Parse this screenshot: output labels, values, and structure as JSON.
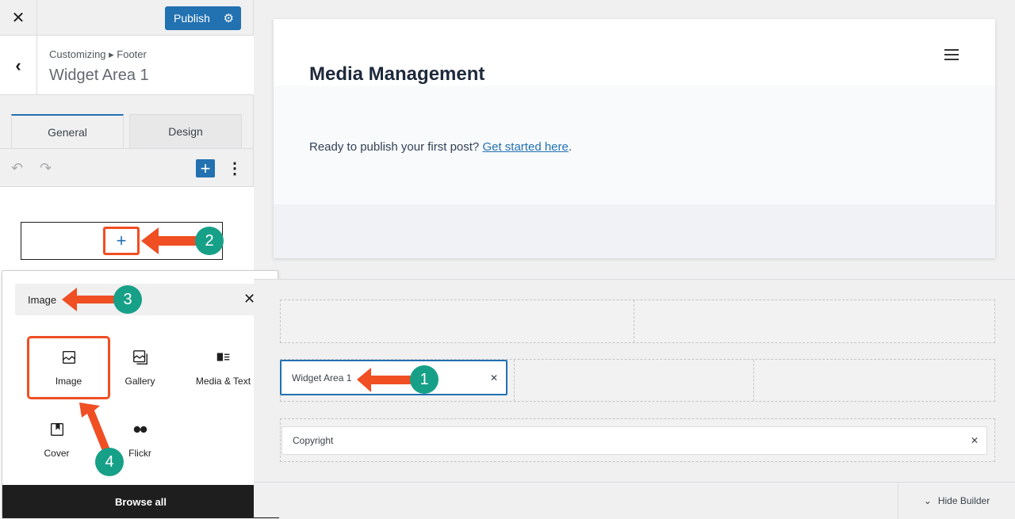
{
  "sidebar": {
    "close_icon": "close-icon",
    "publish_label": "Publish",
    "breadcrumb": "Customizing ▸ Footer",
    "title": "Widget Area 1",
    "tabs": [
      {
        "label": "General",
        "active": true
      },
      {
        "label": "Design",
        "active": false
      }
    ]
  },
  "inserter": {
    "search_value": "Image",
    "blocks": [
      {
        "label": "Image",
        "icon": "image-icon"
      },
      {
        "label": "Gallery",
        "icon": "gallery-icon"
      },
      {
        "label": "Media & Text",
        "icon": "media-text-icon"
      },
      {
        "label": "Cover",
        "icon": "cover-icon"
      },
      {
        "label": "Flickr",
        "icon": "flickr-icon"
      }
    ],
    "browse_all": "Browse all"
  },
  "preview": {
    "site_title": "Media Management",
    "intro_text": "Ready to publish your first post? ",
    "intro_link": "Get started here",
    "intro_end": "."
  },
  "builder": {
    "widget_item": "Widget Area 1",
    "copyright_item": "Copyright",
    "hide_builder": "Hide Builder"
  },
  "annotations": {
    "step1": "1",
    "step2": "2",
    "step3": "3",
    "step4": "4"
  },
  "colors": {
    "accent": "#2271b1",
    "annotation_arrow": "#f04e23",
    "annotation_badge": "#17a088"
  }
}
